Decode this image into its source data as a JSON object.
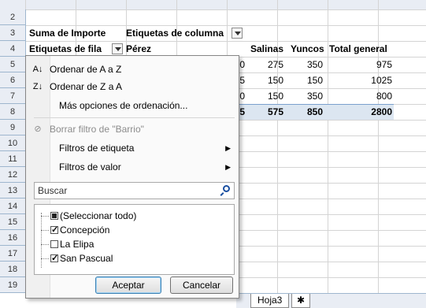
{
  "rows": [
    "2",
    "3",
    "4",
    "5",
    "6",
    "7",
    "8",
    "9",
    "10",
    "11",
    "12",
    "13",
    "14",
    "15",
    "16",
    "17",
    "18",
    "19"
  ],
  "pivot": {
    "sum_label": "Suma de Importe",
    "col_labels": "Etiquetas de columna",
    "row_labels": "Etiquetas de fila",
    "first_col": "Pérez",
    "headers": [
      "Salinas",
      "Yuncos",
      "Total general"
    ],
    "data": [
      [
        "275",
        "350",
        "975"
      ],
      [
        "150",
        "150",
        "1025"
      ],
      [
        "150",
        "350",
        "800"
      ]
    ],
    "totals": [
      "575",
      "850",
      "2800"
    ],
    "partials": [
      "0",
      "5",
      "0",
      "5"
    ]
  },
  "menu": {
    "sort_az": "Ordenar de A a Z",
    "sort_za": "Ordenar de Z a A",
    "more_sort": "Más opciones de ordenación...",
    "clear_filter": "Borrar filtro de \"Barrio\"",
    "label_filters": "Filtros de etiqueta",
    "value_filters": "Filtros de valor",
    "search_placeholder": "Buscar",
    "items": [
      {
        "label": "(Seleccionar todo)",
        "state": "partial"
      },
      {
        "label": "Concepción",
        "state": "checked"
      },
      {
        "label": "La Elipa",
        "state": "unchecked"
      },
      {
        "label": "San Pascual",
        "state": "checked"
      }
    ],
    "ok": "Aceptar",
    "cancel": "Cancelar"
  },
  "tabs": {
    "sheet": "Hoja3"
  }
}
